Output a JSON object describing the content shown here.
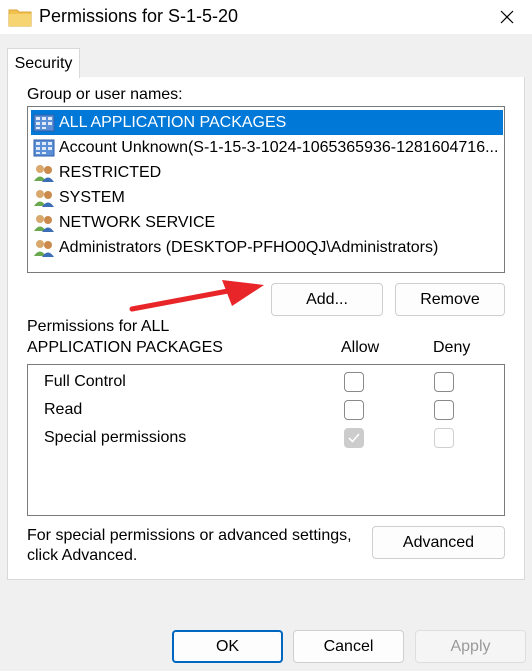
{
  "window": {
    "title": "Permissions for S-1-5-20",
    "close_glyph": "✕",
    "folder_icon": "folder-icon"
  },
  "tabs": [
    {
      "label": "Security"
    }
  ],
  "group": {
    "label": "Group or user names:",
    "items": [
      {
        "label": "ALL APPLICATION PACKAGES",
        "icon": "app-packages-icon",
        "selected": true
      },
      {
        "label": "Account Unknown(S-1-15-3-1024-1065365936-1281604716...",
        "icon": "app-packages-icon",
        "selected": false
      },
      {
        "label": "RESTRICTED",
        "icon": "user-group-icon",
        "selected": false
      },
      {
        "label": "SYSTEM",
        "icon": "user-group-icon",
        "selected": false
      },
      {
        "label": "NETWORK SERVICE",
        "icon": "user-group-icon",
        "selected": false
      },
      {
        "label": "Administrators (DESKTOP-PFHO0QJ\\Administrators)",
        "icon": "user-group-icon",
        "selected": false
      }
    ]
  },
  "buttons": {
    "add": "Add...",
    "remove": "Remove",
    "advanced": "Advanced",
    "ok": "OK",
    "cancel": "Cancel",
    "apply": "Apply"
  },
  "permissions": {
    "title_line1": "Permissions for ALL",
    "title_line2": "APPLICATION PACKAGES",
    "allow_header": "Allow",
    "deny_header": "Deny",
    "rows": [
      {
        "name": "Full Control",
        "allow": "unchecked",
        "deny": "unchecked"
      },
      {
        "name": "Read",
        "allow": "unchecked",
        "deny": "unchecked"
      },
      {
        "name": "Special permissions",
        "allow": "checked-disabled",
        "deny": "disabled"
      }
    ]
  },
  "advanced_note": {
    "line1": "For special permissions or advanced settings,",
    "line2": "click Advanced."
  },
  "colors": {
    "selection": "#0078d7",
    "primary_border": "#0067c0",
    "annotation_arrow": "#e8262a"
  }
}
